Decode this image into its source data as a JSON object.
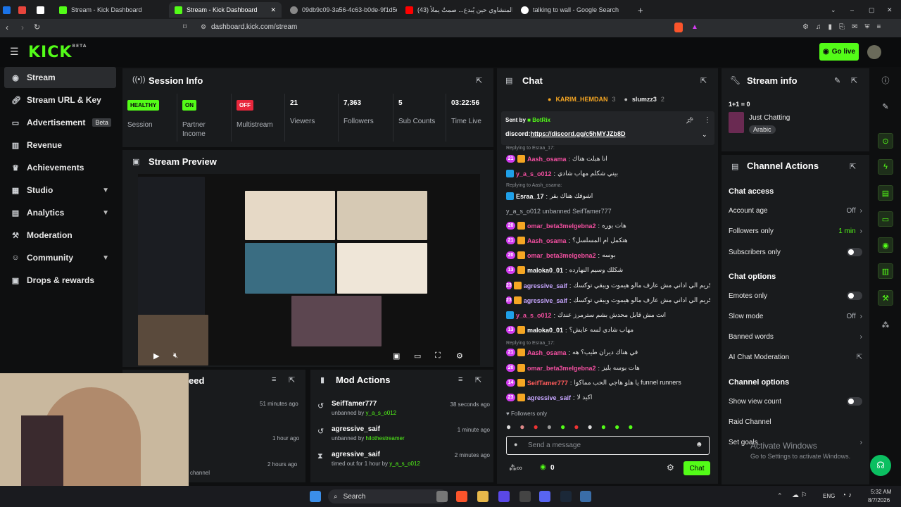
{
  "browser": {
    "tabs": [
      {
        "title": "Stream - Kick Dashboard"
      },
      {
        "title": "Stream - Kick Dashboard"
      },
      {
        "title": "09db9c09-3a56-4c63-b0de-9f1d5d0..."
      },
      {
        "title": "(43) المنشاوي حين يُبدع... صمتٌ يملأ"
      },
      {
        "title": "talking to wall - Google Search"
      }
    ],
    "url": "dashboard.kick.com/stream"
  },
  "header": {
    "logo": "KICK",
    "logo_sup": "BETA",
    "go_live": "Go live"
  },
  "sidebar": {
    "items": [
      {
        "label": "Stream",
        "icon": "broadcast-icon"
      },
      {
        "label": "Stream URL & Key",
        "icon": "link-icon"
      },
      {
        "label": "Advertisement",
        "badge": "Beta",
        "icon": "tv-icon"
      },
      {
        "label": "Revenue",
        "icon": "chart-icon"
      },
      {
        "label": "Achievements",
        "icon": "trophy-icon"
      },
      {
        "label": "Studio",
        "icon": "layout-icon",
        "chevron": true
      },
      {
        "label": "Analytics",
        "icon": "analytics-icon",
        "chevron": true
      },
      {
        "label": "Moderation",
        "icon": "hammer-icon"
      },
      {
        "label": "Community",
        "icon": "people-icon",
        "chevron": true
      },
      {
        "label": "Drops & rewards",
        "icon": "gift-icon"
      }
    ]
  },
  "session": {
    "title": "Session Info",
    "stats": [
      {
        "value": "HEALTHY",
        "label": "Session",
        "kind": "green"
      },
      {
        "value": "ON",
        "label": "Partner Income",
        "kind": "green"
      },
      {
        "value": "OFF",
        "label": "Multistream",
        "kind": "red"
      },
      {
        "value": "21",
        "label": "Viewers"
      },
      {
        "value": "7,363",
        "label": "Followers"
      },
      {
        "value": "5",
        "label": "Sub Counts"
      },
      {
        "value": "03:22:56",
        "label": "Time Live"
      }
    ]
  },
  "preview": {
    "title": "Stream Preview"
  },
  "activity": {
    "title_partial": "eed",
    "times": [
      "51 minutes ago",
      "1 hour ago",
      "2 hours ago"
    ],
    "last_line": "channel"
  },
  "mod_actions": {
    "title": "Mod Actions",
    "rows": [
      {
        "name": "SeifTamer777",
        "action": "unbanned by",
        "by": "y_a_s_o012",
        "time": "38 seconds ago",
        "icon": "undo-icon"
      },
      {
        "name": "agressive_saif",
        "action": "unbanned by",
        "by": "hilothestreamer",
        "time": "1 minute ago",
        "icon": "undo-icon"
      },
      {
        "name": "agressive_saif",
        "action": "timed out for 1 hour by",
        "by": "y_a_s_o012",
        "time": "2 minutes ago",
        "icon": "hourglass-icon"
      }
    ]
  },
  "chat": {
    "title": "Chat",
    "top_gifters": [
      {
        "name": "KARIM_HEMDAN",
        "count": "3"
      },
      {
        "name": "slumzz3",
        "count": "2"
      }
    ],
    "pinned": {
      "sent_by_label": "Sent by",
      "sender": "BotRix",
      "text_prefix": "discord:",
      "link": "https://discord.gg/c5hMYJZb8D"
    },
    "messages": [
      {
        "reply": "Replying to Esraa_17:",
        "user": "Aash_osama",
        "color": "#f24fa0",
        "text": "انا هبلت هناك",
        "badge": "21"
      },
      {
        "user": "y_a_s_o012",
        "color": "#f24fa0",
        "text": "بيني شكلم مهاب شادي",
        "badge": ""
      },
      {
        "reply": "Replying to Aash_osama:",
        "user": "Esraa_17",
        "color": "#ffffff",
        "text": "اشوفك هناك بقر",
        "badge": ""
      },
      {
        "system": true,
        "text": "y_a_s_o012 unbanned SeifTamer777"
      },
      {
        "user": "omar_beta3melgebna2",
        "color": "#f24fa0",
        "text": "هات بوره",
        "badge": "20"
      },
      {
        "user": "Aash_osama",
        "color": "#f24fa0",
        "text": "هتكمل ام المسلسل؟",
        "badge": "21"
      },
      {
        "user": "omar_beta3melgebna2",
        "color": "#f24fa0",
        "text": "بوسه",
        "badge": "20"
      },
      {
        "user": "maloka0_01",
        "color": "#ffffff",
        "text": "شكلك وسيم النهارده",
        "badge": "13"
      },
      {
        "user": "agressive_saif",
        "color": "#c7a6ff",
        "text": "يا كريم الي اداني مش عارف مالو هيموت ويبقي توكسك",
        "badge": "23"
      },
      {
        "user": "agressive_saif",
        "color": "#c7a6ff",
        "text": "يا كريم الي اداني مش عارف مالو هيموت ويبقي توكسك",
        "badge": "23"
      },
      {
        "user": "y_a_s_o012",
        "color": "#f24fa0",
        "text": "انت مش قابل محدش بشم سترمرز عندك",
        "badge": ""
      },
      {
        "user": "maloka0_01",
        "color": "#ffffff",
        "text": "مهاب شادي لسه عايش؟",
        "badge": "13"
      },
      {
        "reply": "Replying to Esraa_17:",
        "user": "Aash_osama",
        "color": "#f24fa0",
        "text": "في هناك ديران طيب؟ هه",
        "badge": "21"
      },
      {
        "user": "omar_beta3melgebna2",
        "color": "#f24fa0",
        "text": "هات بوسه بليز",
        "badge": "20"
      },
      {
        "user": "SeifTamer777",
        "color": "#ff5b5b",
        "text": "يا هلو هاجي الحب مماكوا funnel runners",
        "badge": "14"
      },
      {
        "user": "agressive_saif",
        "color": "#c7a6ff",
        "text": "اكيد لا",
        "badge": "23"
      }
    ],
    "followers_only": "Followers only",
    "input_placeholder": "Send a message",
    "points": "0",
    "send_label": "Chat"
  },
  "stream_info": {
    "title": "Stream info",
    "stream_title": "1+1 = 0",
    "category": "Just Chatting",
    "language": "Arabic"
  },
  "channel_actions": {
    "title": "Channel Actions",
    "chat_access": "Chat access",
    "account_age_label": "Account age",
    "account_age_value": "Off",
    "followers_only_label": "Followers only",
    "followers_only_value": "1 min",
    "subscribers_only_label": "Subscribers only",
    "chat_options": "Chat options",
    "emotes_only_label": "Emotes only",
    "slow_mode_label": "Slow mode",
    "slow_mode_value": "Off",
    "banned_words_label": "Banned words",
    "ai_moderation_label": "AI Chat Moderation",
    "channel_options": "Channel options",
    "show_view_count_label": "Show view count",
    "raid_label": "Raid Channel",
    "set_goals_label": "Set goals"
  },
  "watermark": {
    "line1": "Activate Windows",
    "line2": "Go to Settings to activate Windows."
  },
  "taskbar": {
    "search": "Search",
    "lang": "ENG",
    "time": "5:32 AM",
    "date": "8/7/2026"
  },
  "colors": {
    "accent": "#53fc18",
    "panel": "#191b1d",
    "bg": "#0e0f10"
  }
}
